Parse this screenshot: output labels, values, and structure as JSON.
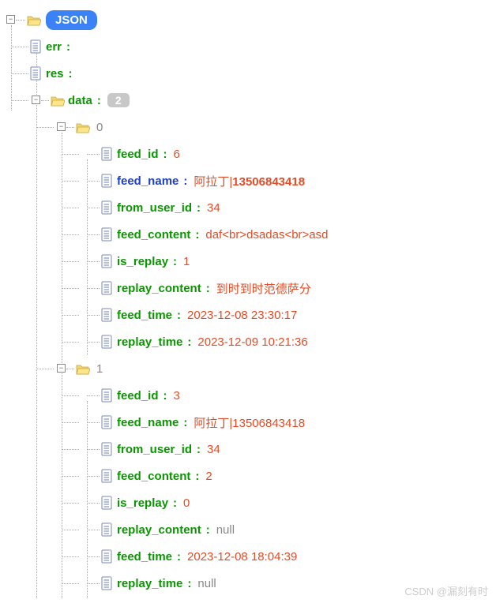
{
  "root_label": "JSON",
  "nodes": {
    "err": {
      "key": "err",
      "value": ""
    },
    "res": {
      "key": "res",
      "value": ""
    },
    "data": {
      "key": "data",
      "count": "2"
    },
    "item0": {
      "idx": "0"
    },
    "item1": {
      "idx": "1"
    },
    "i0_feed_id": {
      "key": "feed_id",
      "value": "6"
    },
    "i0_feed_name": {
      "key": "feed_name",
      "value_a": "阿拉丁|",
      "value_b": "13506843418"
    },
    "i0_from_user_id": {
      "key": "from_user_id",
      "value": "34"
    },
    "i0_feed_content": {
      "key": "feed_content",
      "value": "daf<br>dsadas<br>asd"
    },
    "i0_is_replay": {
      "key": "is_replay",
      "value": "1"
    },
    "i0_replay_content": {
      "key": "replay_content",
      "value": "到时到时范德萨分"
    },
    "i0_feed_time": {
      "key": "feed_time",
      "value": "2023-12-08 23:30:17"
    },
    "i0_replay_time": {
      "key": "replay_time",
      "value": "2023-12-09 10:21:36"
    },
    "i1_feed_id": {
      "key": "feed_id",
      "value": "3"
    },
    "i1_feed_name": {
      "key": "feed_name",
      "value": "阿拉丁|13506843418"
    },
    "i1_from_user_id": {
      "key": "from_user_id",
      "value": "34"
    },
    "i1_feed_content": {
      "key": "feed_content",
      "value": "2"
    },
    "i1_is_replay": {
      "key": "is_replay",
      "value": "0"
    },
    "i1_replay_content": {
      "key": "replay_content",
      "value": "null"
    },
    "i1_feed_time": {
      "key": "feed_time",
      "value": "2023-12-08 18:04:39"
    },
    "i1_replay_time": {
      "key": "replay_time",
      "value": "null"
    }
  },
  "watermark": "CSDN @漏刻有时"
}
